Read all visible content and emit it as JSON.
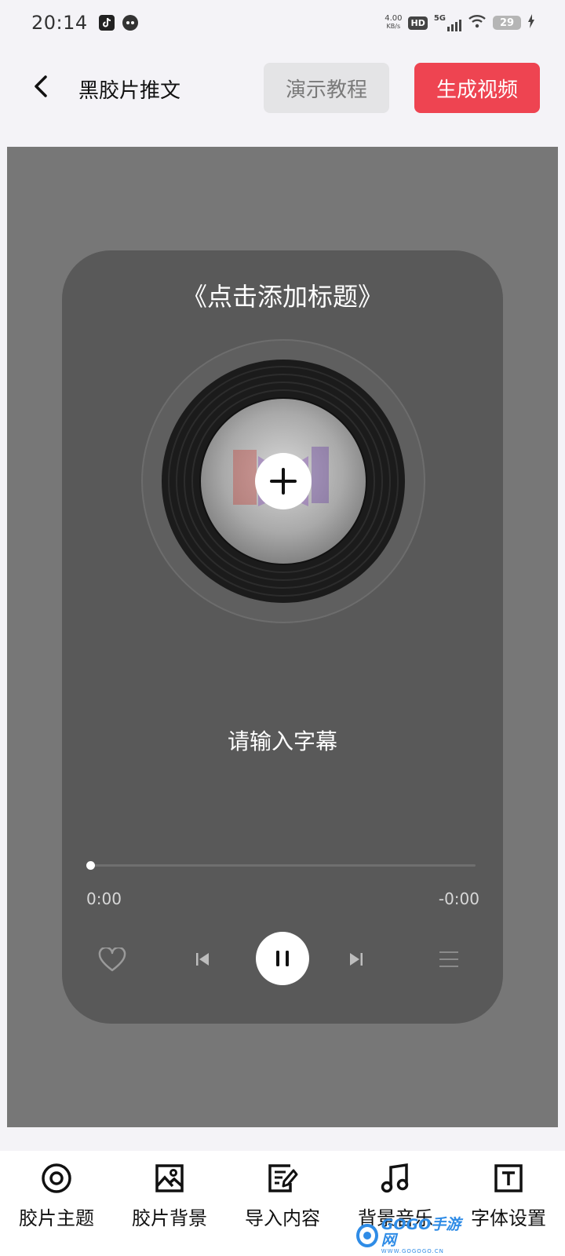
{
  "status_bar": {
    "time": "20:14",
    "net_speed_value": "4.00",
    "net_speed_unit": "KB/s",
    "hd_badge": "HD",
    "signal_label": "5G",
    "battery": "29"
  },
  "header": {
    "title": "黑胶片推文",
    "demo_button": "演示教程",
    "generate_button": "生成视频"
  },
  "player": {
    "title": "《点击添加标题》",
    "subtitle": "请输入字幕",
    "time_current": "0:00",
    "time_remaining": "-0:00",
    "progress": 0
  },
  "bottom_nav": {
    "items": [
      {
        "label": "胶片主题",
        "icon": "target-icon"
      },
      {
        "label": "胶片背景",
        "icon": "image-icon"
      },
      {
        "label": "导入内容",
        "icon": "edit-document-icon"
      },
      {
        "label": "背景音乐",
        "icon": "music-note-icon"
      },
      {
        "label": "字体设置",
        "icon": "text-format-icon"
      }
    ]
  },
  "watermark": {
    "main": "GOGO手游网",
    "sub": "WWW.GOGOGO.CN"
  },
  "colors": {
    "accent": "#ee4451",
    "preview_bg": "#777777",
    "card_bg": "#595959"
  }
}
